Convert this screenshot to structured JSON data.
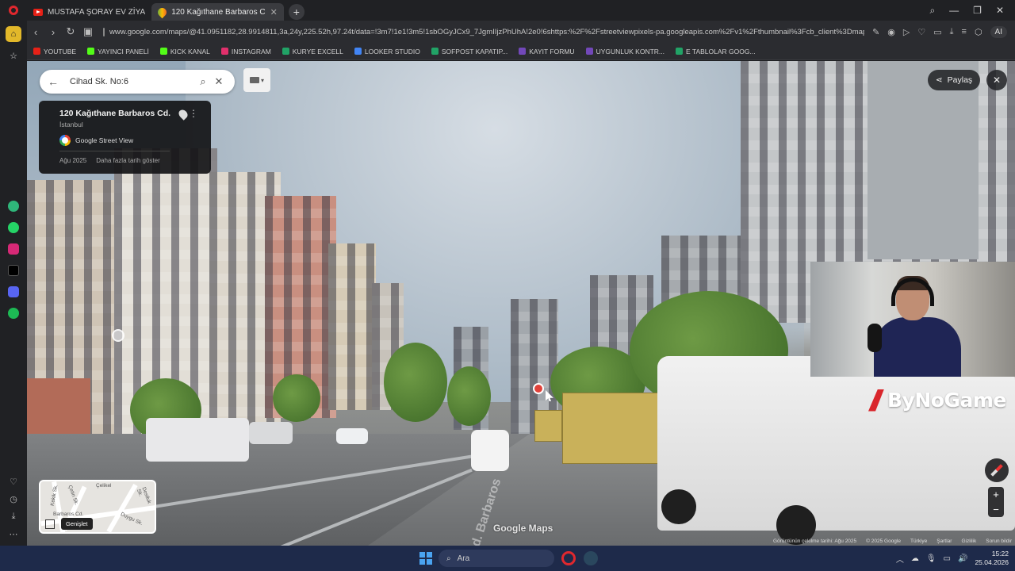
{
  "browser": {
    "tabs": [
      {
        "label": "MUSTAFA ŞORAY EV ZİYA",
        "active": false,
        "icon": "youtube-icon"
      },
      {
        "label": "120 Kağıthane Barbaros C",
        "active": true,
        "icon": "google-maps-icon"
      }
    ],
    "url": "www.google.com/maps/@41.0951182,28.9914811,3a,24y,225.52h,97.24t/data=!3m7!1e1!3m5!1sbOGyJCx9_7JgmIIjzPhUhA!2e0!6shttps:%2F%2Fstreetviewpixels-pa.googleapis.com%2Fv1%2Fthumbnail%3Fcb_client%3Dmaps_sv.t",
    "ai_label": "AI",
    "bookmarks": [
      {
        "label": "YOUTUBE",
        "color": "#e62117"
      },
      {
        "label": "YAYINCI PANELİ",
        "color": "#53fc18"
      },
      {
        "label": "KICK KANAL",
        "color": "#53fc18"
      },
      {
        "label": "INSTAGRAM",
        "color": "#e1306c"
      },
      {
        "label": "KURYE EXCELL",
        "color": "#21a366"
      },
      {
        "label": "LOOKER STUDIO",
        "color": "#4285f4"
      },
      {
        "label": "SOFPOST KAPATIP...",
        "color": "#21a366"
      },
      {
        "label": "KAYIT FORMU",
        "color": "#7248b9"
      },
      {
        "label": "UYGUNLUK KONTR...",
        "color": "#7248b9"
      },
      {
        "label": "E TABLOLAR GOOG...",
        "color": "#21a366"
      }
    ]
  },
  "maps": {
    "search_value": "Cihad Sk. No:6",
    "place": {
      "title": "120 Kağıthane Barbaros Cd.",
      "city": "İstanbul",
      "source": "Google Street View",
      "date": "Ağu 2025",
      "more_dates": "Daha fazla tarih göster"
    },
    "share_label": "Paylaş",
    "minimap": {
      "expand_tooltip": "Genişlet",
      "labels": [
        "Çelikel",
        "Çetin Sk.",
        "Kekik Sk.",
        "Dostluk Sk.",
        "Duygu Sk.",
        "Barbaros Cd."
      ]
    },
    "street_name": "Cd. Barbaros",
    "watermark": "Google Maps",
    "footer": [
      "Görüntünün çekilme tarihi: Ağu 2025",
      "© 2025 Google",
      "Türkiye",
      "Şartlar",
      "Gizlilik",
      "Sorun bildir"
    ],
    "zoom_in": "+",
    "zoom_out": "−"
  },
  "overlay": {
    "brand": "ByNoGame"
  },
  "taskbar": {
    "search_placeholder": "Ara",
    "time": "15:22",
    "date": "25.04.2026"
  }
}
